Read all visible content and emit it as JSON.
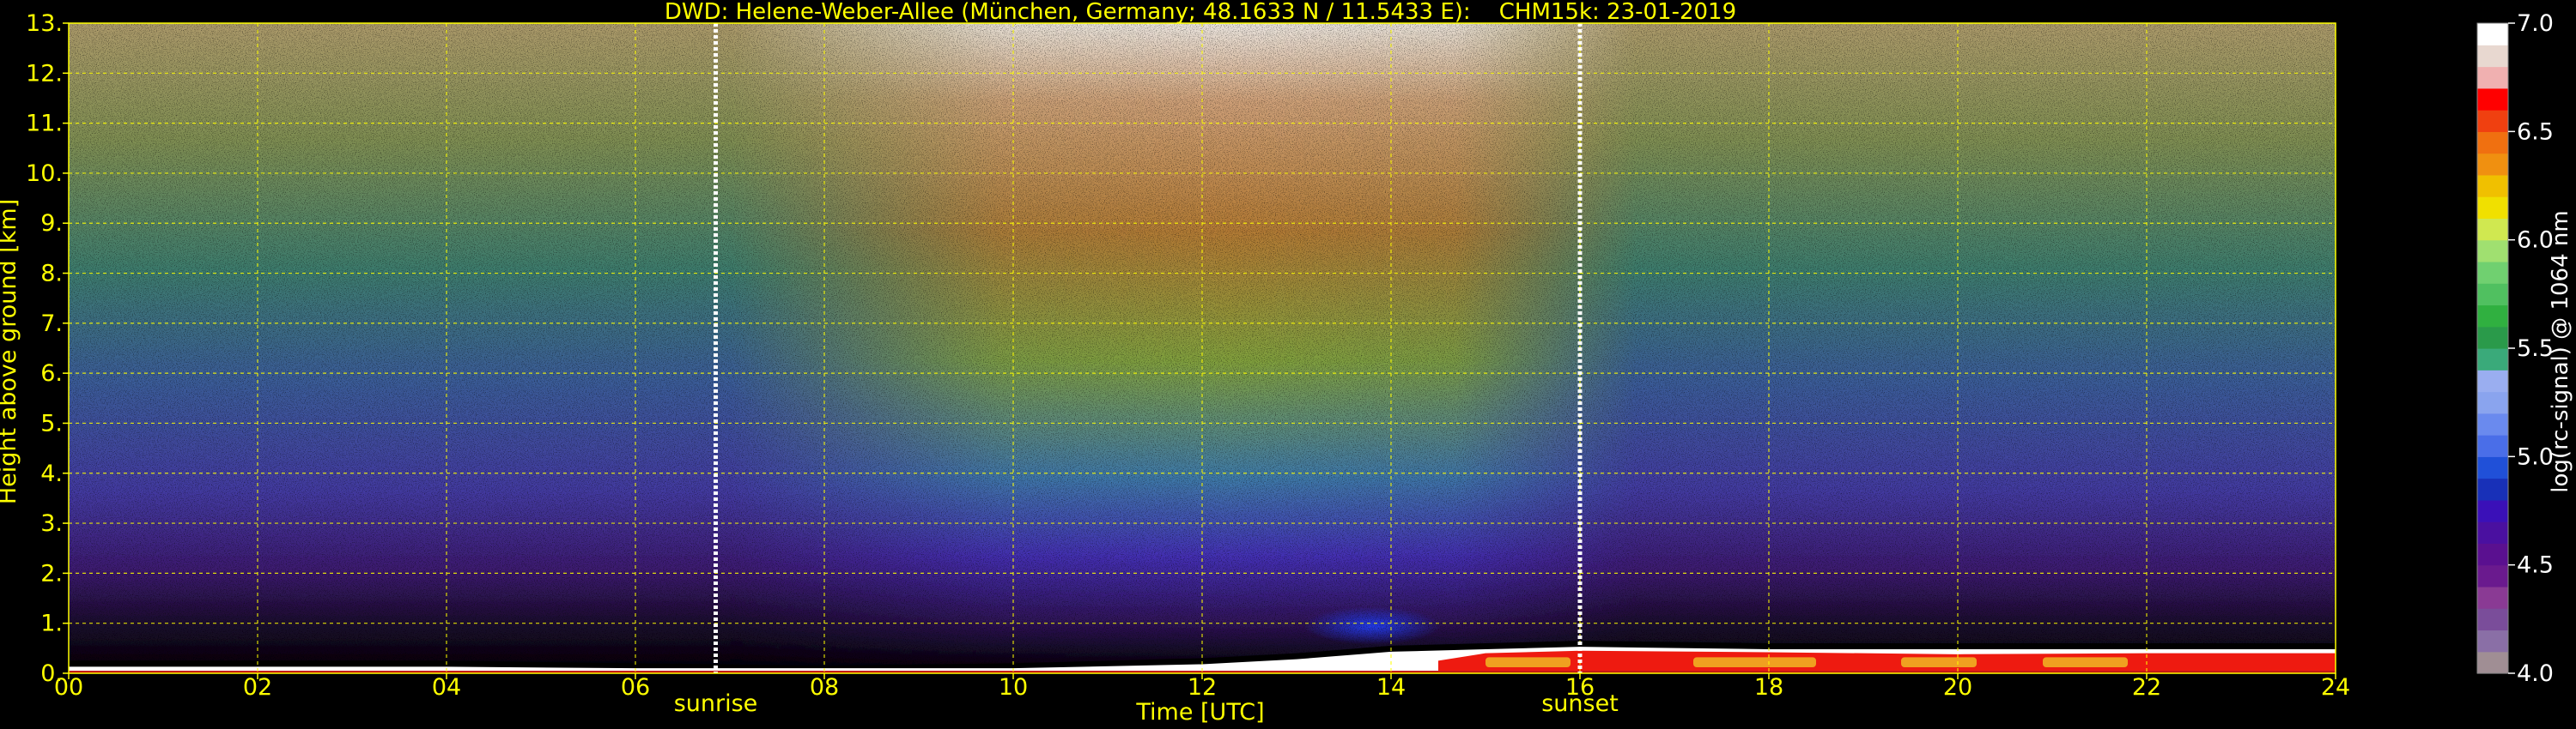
{
  "chart_data": {
    "type": "heatmap",
    "title": "DWD: Helene-Weber-Allee (München, Germany; 48.1633 N / 11.5433 E):    CHM15k: 23-01-2019",
    "xlabel": "Time [UTC]",
    "ylabel": "Height above ground [km]",
    "xlim": [
      0,
      24
    ],
    "ylim": [
      0,
      13
    ],
    "x_ticks": [
      "00",
      "02",
      "04",
      "06",
      "08",
      "10",
      "12",
      "14",
      "16",
      "18",
      "20",
      "22",
      "24"
    ],
    "y_ticks": [
      "0.",
      "1.",
      "2.",
      "3.",
      "4.",
      "5.",
      "6.",
      "7.",
      "8.",
      "9.",
      "10.",
      "11.",
      "12.",
      "13."
    ],
    "grid": true,
    "annotations": [
      {
        "label": "sunrise",
        "time": 6.85
      },
      {
        "label": "sunset",
        "time": 16.0
      }
    ],
    "colorbar": {
      "label": "log(rc-signal) @ 1064 nm",
      "range": [
        4.0,
        7.0
      ],
      "tick_labels": [
        "4.0",
        "4.5",
        "5.0",
        "5.5",
        "6.0",
        "6.5",
        "7.0"
      ],
      "colors": [
        "#a08e94",
        "#8a6fa6",
        "#7a4d9a",
        "#8a3a94",
        "#6a1a8e",
        "#5a1090",
        "#4a10a0",
        "#3a10b8",
        "#1830b8",
        "#2050d8",
        "#4a6ee8",
        "#6a8aee",
        "#8aa4ee",
        "#9aaef0",
        "#3aaa7a",
        "#2a9a4a",
        "#30b040",
        "#50c060",
        "#70d070",
        "#a0e070",
        "#d0e850",
        "#f0e000",
        "#f0c000",
        "#f09010",
        "#f07010",
        "#f04010",
        "#ff0000",
        "#f0b0b0",
        "#e8d8d0",
        "#ffffff"
      ]
    },
    "series": [
      {
        "name": "signal top",
        "x": [
          0,
          4,
          6,
          8,
          10,
          12,
          13,
          14,
          15,
          16,
          18,
          20,
          22,
          24
        ],
        "y": [
          0.25,
          0.25,
          0.2,
          0.15,
          0.2,
          0.3,
          0.4,
          0.55,
          0.6,
          0.65,
          0.6,
          0.6,
          0.6,
          0.6
        ]
      },
      {
        "name": "red layer top",
        "x": [
          14.5,
          15,
          16,
          18,
          20,
          22,
          24
        ],
        "y": [
          0.25,
          0.4,
          0.45,
          0.42,
          0.38,
          0.4,
          0.4
        ]
      }
    ]
  },
  "page": {
    "background": "#000000",
    "label_color": "#ffff00",
    "grid_color": "#ffff00"
  }
}
